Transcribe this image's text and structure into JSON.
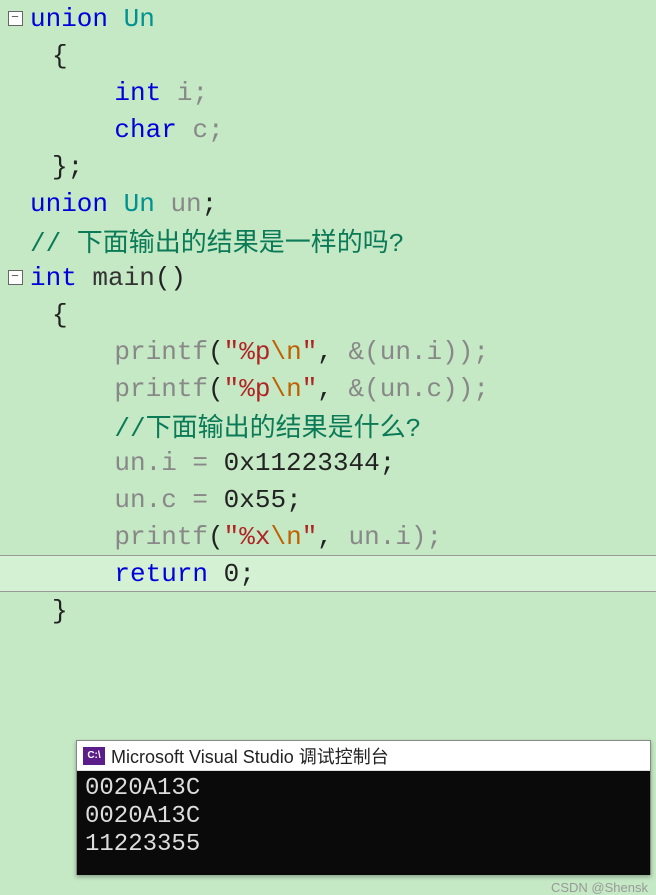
{
  "code": {
    "l1_kw": "union",
    "l1_type": " Un",
    "l2": "{",
    "l3_kw": "int",
    "l3_rest": " i;",
    "l4_kw": "char",
    "l4_rest": " c;",
    "l5": "};",
    "l6_kw": "union",
    "l6_type": " Un ",
    "l6_id": "un",
    "l6_semi": ";",
    "l7_comment": "// 下面输出的结果是一样的吗?",
    "l8_kw": "int",
    "l8_fn": " main",
    "l8_p": "()",
    "l9": "{",
    "l10_fn": "printf",
    "l10_p1": "(",
    "l10_s1": "\"%p",
    "l10_esc": "\\n",
    "l10_s2": "\"",
    "l10_p2": ", ",
    "l10_arg": "&(un.i));",
    "l11_fn": "printf",
    "l11_p1": "(",
    "l11_s1": "\"%p",
    "l11_esc": "\\n",
    "l11_s2": "\"",
    "l11_p2": ", ",
    "l11_arg": "&(un.c));",
    "l12_comment": "//下面输出的结果是什么?",
    "l13_lhs": "un.i = ",
    "l13_val": "0x11223344",
    "l13_semi": ";",
    "l14_lhs": "un.c = ",
    "l14_val": "0x55",
    "l14_semi": ";",
    "l15_fn": "printf",
    "l15_p1": "(",
    "l15_s1": "\"%x",
    "l15_esc": "\\n",
    "l15_s2": "\"",
    "l15_p2": ", ",
    "l15_arg": "un.i);",
    "l16_kw": "return",
    "l16_rest": " 0;",
    "l17": "}"
  },
  "console": {
    "icon_text": "C:\\",
    "title": "Microsoft Visual Studio 调试控制台",
    "out1": "0020A13C",
    "out2": "0020A13C",
    "out3": "11223355"
  },
  "watermark": "CSDN @Shensk"
}
